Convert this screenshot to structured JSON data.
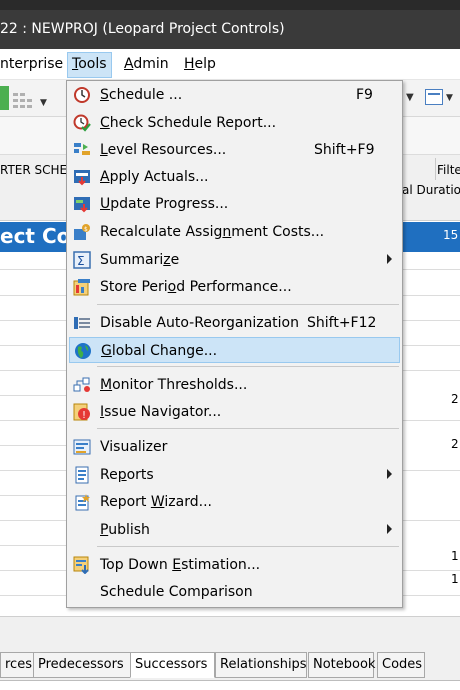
{
  "window": {
    "title": "22 : NEWPROJ (Leopard Project Controls)"
  },
  "menubar": {
    "items": [
      {
        "pre": "",
        "key": "",
        "rest": "nterprise"
      },
      {
        "pre": "",
        "key": "T",
        "rest": "ools"
      },
      {
        "pre": "",
        "key": "A",
        "rest": "dmin"
      },
      {
        "pre": "",
        "key": "H",
        "rest": "elp"
      }
    ]
  },
  "grid": {
    "col_header_left": "RTER SCHE",
    "col_header_right_top": "Filte",
    "col_header_right_bottom": "al Duratio",
    "project_row_text": "ect Con",
    "project_row_value": "15",
    "right_values": [
      "2",
      "2",
      "1",
      "1"
    ]
  },
  "tools_menu": {
    "items": [
      {
        "pre": "",
        "key": "S",
        "post": "chedule ...",
        "shortcut": "F9",
        "icon": "schedule-icon"
      },
      {
        "pre": "",
        "key": "C",
        "post": "heck Schedule Report...",
        "shortcut": "",
        "icon": "check-schedule-icon"
      },
      {
        "pre": "",
        "key": "L",
        "post": "evel Resources...",
        "shortcut": "Shift+F9",
        "icon": "level-resources-icon"
      },
      {
        "pre": "",
        "key": "A",
        "post": "pply Actuals...",
        "shortcut": "",
        "icon": "apply-actuals-icon"
      },
      {
        "pre": "",
        "key": "U",
        "post": "pdate Progress...",
        "shortcut": "",
        "icon": "update-progress-icon"
      },
      {
        "pre": "Recalculate Assig",
        "key": "n",
        "post": "ment Costs...",
        "shortcut": "",
        "icon": "recalculate-costs-icon"
      },
      {
        "pre": "Summari",
        "key": "z",
        "post": "e",
        "shortcut": "",
        "icon": "summarize-icon",
        "submenu": true
      },
      {
        "pre": "Store Peri",
        "key": "o",
        "post": "d Performance...",
        "shortcut": "",
        "icon": "store-period-icon"
      },
      {
        "pre": "Disable Auto-Reorganization",
        "key": "",
        "post": "",
        "shortcut": "Shift+F12",
        "icon": "disable-reorg-icon"
      },
      {
        "pre": "",
        "key": "G",
        "post": "lobal Change...",
        "shortcut": "",
        "icon": "globe-icon",
        "highlight": true
      },
      {
        "pre": "",
        "key": "M",
        "post": "onitor Thresholds...",
        "shortcut": "",
        "icon": "monitor-thresholds-icon"
      },
      {
        "pre": "",
        "key": "I",
        "post": "ssue Navigator...",
        "shortcut": "",
        "icon": "issue-navigator-icon"
      },
      {
        "pre": "Visualizer",
        "key": "",
        "post": "",
        "shortcut": "",
        "icon": "visualizer-icon"
      },
      {
        "pre": "Re",
        "key": "p",
        "post": "orts",
        "shortcut": "",
        "icon": "reports-icon",
        "submenu": true
      },
      {
        "pre": "Report ",
        "key": "W",
        "post": "izard...",
        "shortcut": "",
        "icon": "report-wizard-icon"
      },
      {
        "pre": "",
        "key": "P",
        "post": "ublish",
        "shortcut": "",
        "icon": "",
        "submenu": true
      },
      {
        "pre": "Top Down ",
        "key": "E",
        "post": "stimation...",
        "shortcut": "",
        "icon": "top-down-icon"
      },
      {
        "pre": "Schedule Comparison",
        "key": "",
        "post": "",
        "shortcut": "",
        "icon": ""
      }
    ]
  },
  "bottom_tabs": [
    "rces",
    "Predecessors",
    "Successors",
    "Relationships",
    "Notebook",
    "Codes"
  ],
  "colors": {
    "accent": "#1f6fc0",
    "highlight": "#cce4f7",
    "titlebar": "#3a3a3a"
  }
}
